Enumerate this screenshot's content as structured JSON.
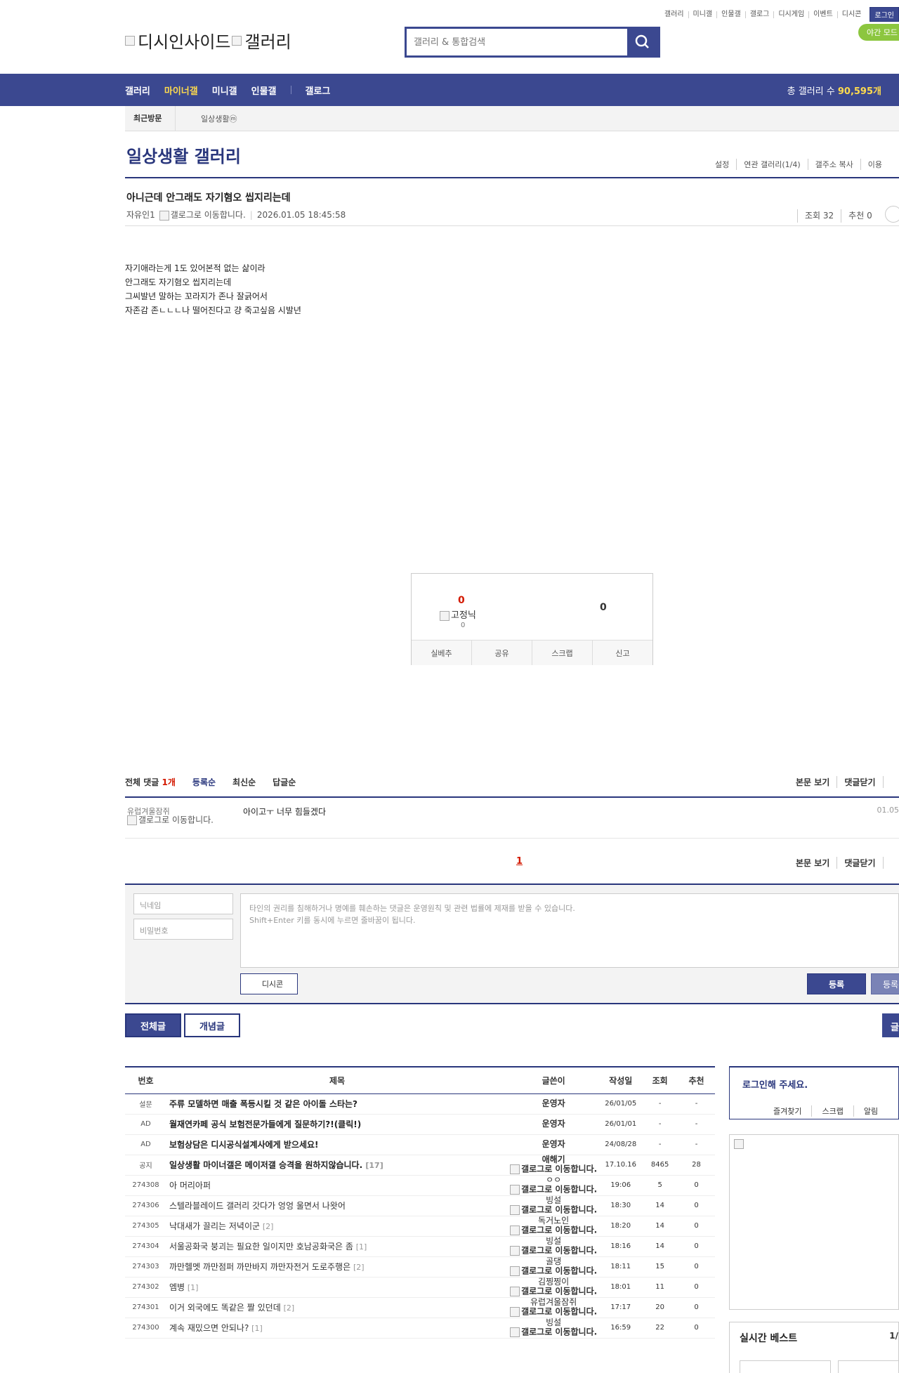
{
  "util": {
    "links": [
      "갤러리",
      "미니갤",
      "인물갤",
      "갤로그",
      "디시게임",
      "이벤트",
      "디시콘"
    ],
    "login": "로그인",
    "night": "야간 모드"
  },
  "logo": {
    "site": "디시인사이드",
    "gallery": "갤러리"
  },
  "search": {
    "placeholder": "갤러리 & 통합검색"
  },
  "gnb": {
    "items": [
      "갤러리",
      "마이너갤",
      "미니갤",
      "인물갤",
      "갤로그"
    ],
    "total_label": "총 갤러리 수 ",
    "total_value": "90,595개"
  },
  "visit": {
    "label": "최근방문",
    "item": "일상생활ⓜ"
  },
  "gallery": {
    "title": "일상생활 갤러리",
    "options": [
      "설정",
      "연관 갤러리(1/4)",
      "갤주소 복사",
      "이용"
    ]
  },
  "post": {
    "title": "아니근데 안그래도 자기혐오 씹지리는데",
    "writer": "자유인1",
    "move_alt": "갤로그로 이동합니다.",
    "date": "2026.01.05 18:45:58",
    "views": "조회 32",
    "recommends": "추천 0",
    "body": [
      "자기애라는게 1도 있어본적 없는 삶이라",
      "안그래도 자기혐오 씹지리는데",
      "그씨발년 말하는 꼬라지가 존나 잘긁어서",
      "자존감 존ㄴㄴㄴ나 떨어진다고 걍 죽고싶음 시발년"
    ]
  },
  "vote": {
    "up": "0",
    "nick": "고정닉",
    "up_sub": "0",
    "down": "0",
    "buttons": [
      "실베추",
      "공유",
      "스크랩",
      "신고"
    ]
  },
  "comments": {
    "total_label": "전체 댓글 ",
    "total_count": "1개",
    "sorts": [
      "등록순",
      "최신순",
      "답글순"
    ],
    "right": [
      "본문 보기",
      "댓글닫기"
    ],
    "items": [
      {
        "nick": "유럽겨울잠쥐",
        "move": "갤로그로 이동합니다.",
        "text": "아이고ㅜ 너무 힘들겠다",
        "date": "01.05"
      }
    ],
    "page": "1",
    "form": {
      "nick_placeholder": "닉네임",
      "pw_placeholder": "비밀번호",
      "notice1": "타인의 권리를 침해하거나 명예를 훼손하는 댓글은 운영원칙 및 관련 법률에 제재를 받을 수 있습니다.",
      "notice2": "Shift+Enter 키를 동시에 누르면 줄바꿈이 됩니다.",
      "dccon": "디시콘",
      "submit": "등록",
      "submit2": "등록"
    }
  },
  "tabs": {
    "all": "전체글",
    "concept": "개념글",
    "right": "글"
  },
  "list": {
    "headers": [
      "번호",
      "제목",
      "글쓴이",
      "작성일",
      "조회",
      "추천"
    ],
    "rows": [
      {
        "num": "설문",
        "title": "주류 모델하면 매출 폭등시킬 것 같은 아이돌 스타는?",
        "reply": "",
        "writer": "운영자",
        "move": "",
        "date": "26/01/05",
        "views": "-",
        "rec": "-",
        "notice": true
      },
      {
        "num": "AD",
        "title": "월재연카페 공식 보험전문가들에게 질문하기?!(클릭!)",
        "reply": "",
        "writer": "운영자",
        "move": "",
        "date": "26/01/01",
        "views": "-",
        "rec": "-",
        "notice": true
      },
      {
        "num": "AD",
        "title": "보험상담은 디시공식설계사에게 받으세요!",
        "reply": "",
        "writer": "운영자",
        "move": "",
        "date": "24/08/28",
        "views": "-",
        "rec": "-",
        "notice": true
      },
      {
        "num": "공지",
        "title": "일상생활 마이너갤은 메이저갤 승격을 원하지않습니다.",
        "reply": "[17]",
        "writer": "애해기",
        "move": "갤로그로 이동합니다.",
        "date": "17.10.16",
        "views": "8465",
        "rec": "28",
        "notice": true
      },
      {
        "num": "274308",
        "title": "아 머리아퍼",
        "reply": "",
        "writer": "ㅇㅇ",
        "move": "갤로그로 이동합니다.",
        "date": "19:06",
        "views": "5",
        "rec": "0",
        "notice": false
      },
      {
        "num": "274306",
        "title": "스텔라블레이드 갤러리 갓다가 엉엉 울면서 나왓어",
        "reply": "",
        "writer": "빙설",
        "move": "갤로그로 이동합니다.",
        "date": "18:30",
        "views": "14",
        "rec": "0",
        "notice": false
      },
      {
        "num": "274305",
        "title": "낙대새가 끌리는 저녁이군",
        "reply": "[2]",
        "writer": "독거노인",
        "move": "갤로그로 이동합니다.",
        "date": "18:20",
        "views": "14",
        "rec": "0",
        "notice": false
      },
      {
        "num": "274304",
        "title": "서울공화국 붕괴는 필요한 일이지만 호남공화국은 좀",
        "reply": "[1]",
        "writer": "빙설",
        "move": "갤로그로 이동합니다.",
        "date": "18:16",
        "views": "14",
        "rec": "0",
        "notice": false
      },
      {
        "num": "274303",
        "title": "까만헬멧 까만점퍼 까만바지 까만자전거 도로주행은",
        "reply": "[2]",
        "writer": "골댕",
        "move": "갤로그로 이동합니다.",
        "date": "18:11",
        "views": "15",
        "rec": "0",
        "notice": false
      },
      {
        "num": "274302",
        "title": "엠병",
        "reply": "[1]",
        "writer": "김찡찡이",
        "move": "갤로그로 이동합니다.",
        "date": "18:01",
        "views": "11",
        "rec": "0",
        "notice": false
      },
      {
        "num": "274301",
        "title": "이거 외국에도 똑같은 짤 있던데",
        "reply": "[2]",
        "writer": "유럽겨울잠쥐",
        "move": "갤로그로 이동합니다.",
        "date": "17:17",
        "views": "20",
        "rec": "0",
        "notice": false
      },
      {
        "num": "274300",
        "title": "계속 재밌으면 안되나?",
        "reply": "[1]",
        "writer": "빙설",
        "move": "갤로그로 이동합니다.",
        "date": "16:59",
        "views": "22",
        "rec": "0",
        "notice": false
      }
    ]
  },
  "sidebar": {
    "login_title": "로그인해 주세요.",
    "login_opts": [
      "즐겨찾기",
      "스크랩",
      "알림"
    ],
    "best_title": "실시간 베스트",
    "best_page": "1/"
  },
  "colors": {
    "brand": "#3b4890",
    "brand_dark": "#29367c",
    "highlight": "#ffdb4d",
    "red": "#d31900"
  }
}
